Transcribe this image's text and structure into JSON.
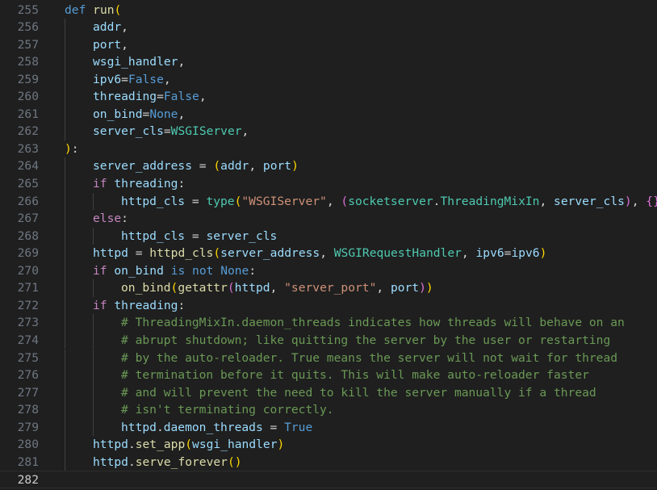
{
  "editor": {
    "current_line": 282,
    "lines": [
      {
        "n": 255,
        "indent": 0,
        "tokens": [
          [
            "kw",
            "def"
          ],
          [
            "op",
            " "
          ],
          [
            "fn",
            "run"
          ],
          [
            "p1",
            "("
          ]
        ]
      },
      {
        "n": 256,
        "indent": 1,
        "tokens": [
          [
            "var",
            "addr"
          ],
          [
            "op",
            ","
          ]
        ]
      },
      {
        "n": 257,
        "indent": 1,
        "tokens": [
          [
            "var",
            "port"
          ],
          [
            "op",
            ","
          ]
        ]
      },
      {
        "n": 258,
        "indent": 1,
        "tokens": [
          [
            "var",
            "wsgi_handler"
          ],
          [
            "op",
            ","
          ]
        ]
      },
      {
        "n": 259,
        "indent": 1,
        "tokens": [
          [
            "var",
            "ipv6"
          ],
          [
            "op",
            "="
          ],
          [
            "kw",
            "False"
          ],
          [
            "op",
            ","
          ]
        ]
      },
      {
        "n": 260,
        "indent": 1,
        "tokens": [
          [
            "var",
            "threading"
          ],
          [
            "op",
            "="
          ],
          [
            "kw",
            "False"
          ],
          [
            "op",
            ","
          ]
        ]
      },
      {
        "n": 261,
        "indent": 1,
        "tokens": [
          [
            "var",
            "on_bind"
          ],
          [
            "op",
            "="
          ],
          [
            "kw",
            "None"
          ],
          [
            "op",
            ","
          ]
        ]
      },
      {
        "n": 262,
        "indent": 1,
        "tokens": [
          [
            "var",
            "server_cls"
          ],
          [
            "op",
            "="
          ],
          [
            "cls",
            "WSGIServer"
          ],
          [
            "op",
            ","
          ]
        ]
      },
      {
        "n": 263,
        "indent": 0,
        "tokens": [
          [
            "p1",
            ")"
          ],
          [
            "op",
            ":"
          ]
        ]
      },
      {
        "n": 264,
        "indent": 1,
        "tokens": [
          [
            "var",
            "server_address"
          ],
          [
            "op",
            " = "
          ],
          [
            "p1",
            "("
          ],
          [
            "var",
            "addr"
          ],
          [
            "op",
            ", "
          ],
          [
            "var",
            "port"
          ],
          [
            "p1",
            ")"
          ]
        ]
      },
      {
        "n": 265,
        "indent": 1,
        "tokens": [
          [
            "ctl",
            "if"
          ],
          [
            "op",
            " "
          ],
          [
            "var",
            "threading"
          ],
          [
            "op",
            ":"
          ]
        ]
      },
      {
        "n": 266,
        "indent": 2,
        "tokens": [
          [
            "var",
            "httpd_cls"
          ],
          [
            "op",
            " = "
          ],
          [
            "cls",
            "type"
          ],
          [
            "p1",
            "("
          ],
          [
            "str",
            "\"WSGIServer\""
          ],
          [
            "op",
            ", "
          ],
          [
            "p2",
            "("
          ],
          [
            "cls",
            "socketserver"
          ],
          [
            "op",
            "."
          ],
          [
            "cls",
            "ThreadingMixIn"
          ],
          [
            "op",
            ", "
          ],
          [
            "var",
            "server_cls"
          ],
          [
            "p2",
            ")"
          ],
          [
            "op",
            ", "
          ],
          [
            "p2",
            "{}"
          ],
          [
            "p1",
            ")"
          ]
        ]
      },
      {
        "n": 267,
        "indent": 1,
        "tokens": [
          [
            "ctl",
            "else"
          ],
          [
            "op",
            ":"
          ]
        ]
      },
      {
        "n": 268,
        "indent": 2,
        "tokens": [
          [
            "var",
            "httpd_cls"
          ],
          [
            "op",
            " = "
          ],
          [
            "var",
            "server_cls"
          ]
        ]
      },
      {
        "n": 269,
        "indent": 1,
        "tokens": [
          [
            "var",
            "httpd"
          ],
          [
            "op",
            " = "
          ],
          [
            "fn",
            "httpd_cls"
          ],
          [
            "p1",
            "("
          ],
          [
            "var",
            "server_address"
          ],
          [
            "op",
            ", "
          ],
          [
            "cls",
            "WSGIRequestHandler"
          ],
          [
            "op",
            ", "
          ],
          [
            "var",
            "ipv6"
          ],
          [
            "op",
            "="
          ],
          [
            "var",
            "ipv6"
          ],
          [
            "p1",
            ")"
          ]
        ]
      },
      {
        "n": 270,
        "indent": 1,
        "tokens": [
          [
            "ctl",
            "if"
          ],
          [
            "op",
            " "
          ],
          [
            "var",
            "on_bind"
          ],
          [
            "op",
            " "
          ],
          [
            "kw",
            "is not"
          ],
          [
            "op",
            " "
          ],
          [
            "kw",
            "None"
          ],
          [
            "op",
            ":"
          ]
        ]
      },
      {
        "n": 271,
        "indent": 2,
        "tokens": [
          [
            "fn",
            "on_bind"
          ],
          [
            "p1",
            "("
          ],
          [
            "fn",
            "getattr"
          ],
          [
            "p2",
            "("
          ],
          [
            "var",
            "httpd"
          ],
          [
            "op",
            ", "
          ],
          [
            "str",
            "\"server_port\""
          ],
          [
            "op",
            ", "
          ],
          [
            "var",
            "port"
          ],
          [
            "p2",
            ")"
          ],
          [
            "p1",
            ")"
          ]
        ]
      },
      {
        "n": 272,
        "indent": 1,
        "tokens": [
          [
            "ctl",
            "if"
          ],
          [
            "op",
            " "
          ],
          [
            "var",
            "threading"
          ],
          [
            "op",
            ":"
          ]
        ]
      },
      {
        "n": 273,
        "indent": 2,
        "tokens": [
          [
            "com",
            "# ThreadingMixIn.daemon_threads indicates how threads will behave on an"
          ]
        ]
      },
      {
        "n": 274,
        "indent": 2,
        "tokens": [
          [
            "com",
            "# abrupt shutdown; like quitting the server by the user or restarting"
          ]
        ]
      },
      {
        "n": 275,
        "indent": 2,
        "tokens": [
          [
            "com",
            "# by the auto-reloader. True means the server will not wait for thread"
          ]
        ]
      },
      {
        "n": 276,
        "indent": 2,
        "tokens": [
          [
            "com",
            "# termination before it quits. This will make auto-reloader faster"
          ]
        ]
      },
      {
        "n": 277,
        "indent": 2,
        "tokens": [
          [
            "com",
            "# and will prevent the need to kill the server manually if a thread"
          ]
        ]
      },
      {
        "n": 278,
        "indent": 2,
        "tokens": [
          [
            "com",
            "# isn't terminating correctly."
          ]
        ]
      },
      {
        "n": 279,
        "indent": 2,
        "tokens": [
          [
            "var",
            "httpd"
          ],
          [
            "op",
            "."
          ],
          [
            "var",
            "daemon_threads"
          ],
          [
            "op",
            " = "
          ],
          [
            "kw",
            "True"
          ]
        ]
      },
      {
        "n": 280,
        "indent": 1,
        "tokens": [
          [
            "var",
            "httpd"
          ],
          [
            "op",
            "."
          ],
          [
            "fn",
            "set_app"
          ],
          [
            "p1",
            "("
          ],
          [
            "var",
            "wsgi_handler"
          ],
          [
            "p1",
            ")"
          ]
        ]
      },
      {
        "n": 281,
        "indent": 1,
        "tokens": [
          [
            "var",
            "httpd"
          ],
          [
            "op",
            "."
          ],
          [
            "fn",
            "serve_forever"
          ],
          [
            "p1",
            "("
          ],
          [
            "p1",
            ")"
          ]
        ]
      },
      {
        "n": 282,
        "indent": 0,
        "tokens": []
      }
    ]
  }
}
